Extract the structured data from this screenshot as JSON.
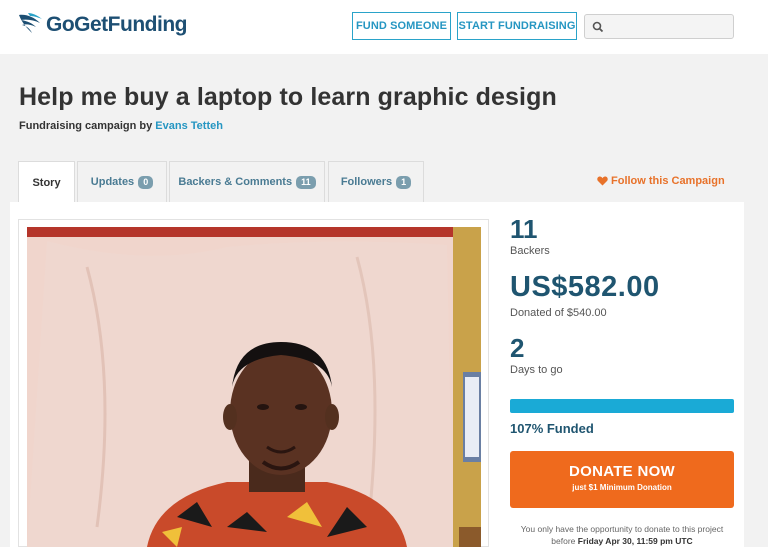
{
  "header": {
    "logo_text": "GoGetFunding",
    "fund_someone_label": "FUND SOMEONE",
    "start_fundraising_label": "START FUNDRAISING",
    "search_placeholder": ""
  },
  "campaign": {
    "title": "Help me buy a laptop to learn graphic design",
    "byline_prefix": "Fundraising campaign by ",
    "author": "Evans Tetteh"
  },
  "tabs": [
    {
      "label": "Story",
      "count": null,
      "active": true
    },
    {
      "label": "Updates",
      "count": "0"
    },
    {
      "label": "Backers & Comments",
      "count": "11"
    },
    {
      "label": "Followers",
      "count": "1"
    }
  ],
  "follow_label": "Follow this Campaign",
  "stats": {
    "backers_count": "11",
    "backers_label": "Backers",
    "raised": "US$582.00",
    "goal_label": "Donated of $540.00",
    "days": "2",
    "days_label": "Days to go",
    "progress_fraction": 1.0,
    "funded_label": "107% Funded"
  },
  "donate": {
    "label": "DONATE NOW",
    "sublabel": "just $1 Minimum Donation"
  },
  "deadline": {
    "text_prefix": "You only have the opportunity to donate to this project before ",
    "date": "Friday Apr 30, 11:59 pm UTC"
  },
  "colors": {
    "brand_blue": "#1d4f73",
    "accent_cyan": "#2596c2",
    "donate_orange": "#ef6a1d",
    "progress_fill": "#1aaad6"
  },
  "icons": {
    "logo": "bird-wing-logo-icon",
    "search": "search-icon",
    "follow": "heart-icon"
  }
}
